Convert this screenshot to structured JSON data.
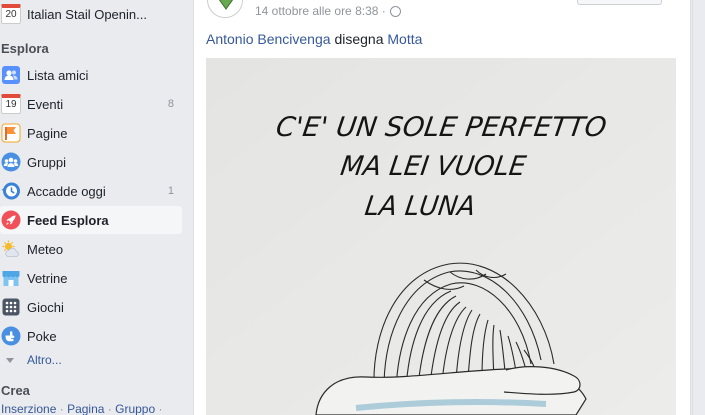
{
  "sidebar": {
    "top_item": {
      "label": "Italian Stail Openin...",
      "icon": "calendar-icon",
      "day": "20"
    },
    "explore_heading": "Esplora",
    "items": [
      {
        "label": "Lista amici",
        "icon": "friends-list-icon",
        "count": ""
      },
      {
        "label": "Eventi",
        "icon": "calendar-icon",
        "day": "19",
        "count": "8"
      },
      {
        "label": "Pagine",
        "icon": "flag-icon",
        "count": ""
      },
      {
        "label": "Gruppi",
        "icon": "groups-icon",
        "count": ""
      },
      {
        "label": "Accadde oggi",
        "icon": "memories-clock-icon",
        "count": "1"
      },
      {
        "label": "Feed Esplora",
        "icon": "rocket-icon",
        "count": ""
      },
      {
        "label": "Meteo",
        "icon": "weather-sun-cloud-icon",
        "count": ""
      },
      {
        "label": "Vetrine",
        "icon": "storefront-icon",
        "count": ""
      },
      {
        "label": "Giochi",
        "icon": "games-icon",
        "count": ""
      },
      {
        "label": "Poke",
        "icon": "poke-hand-icon",
        "count": ""
      }
    ],
    "more_label": "Altro...",
    "create_heading": "Crea",
    "create_links": [
      "Inserzione",
      "Pagina",
      "Gruppo"
    ]
  },
  "post": {
    "timestamp": "14 ottobre alle ore 8:38 ·",
    "author": "Antonio Bencivenga",
    "verb": "disegna",
    "subject": "Motta",
    "image_text": [
      "C'E' UN SOLE PERFETTO",
      "MA LEI VUOLE",
      "LA LUNA"
    ]
  },
  "colors": {
    "background": "#e9ebee",
    "link": "#365899",
    "text": "#1d2129",
    "muted": "#90949c",
    "active_row": "#f5f6f7"
  }
}
